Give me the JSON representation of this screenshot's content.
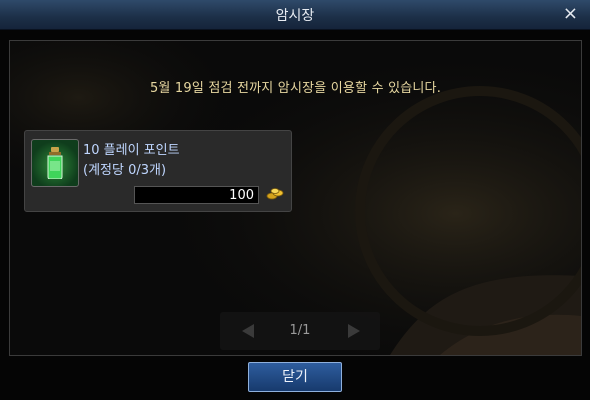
{
  "window": {
    "title": "암시장",
    "close_glyph": "×"
  },
  "notice": "5월 19일 점검 전까지 암시장을 이용할 수 있습니다.",
  "item": {
    "name": "10 플레이 포인트",
    "limit": "(계정당 0/3개)",
    "price": "100",
    "icon": "potion-bottle-icon",
    "currency_icon": "gold-coins-icon"
  },
  "pager": {
    "page": "1/1"
  },
  "footer": {
    "close_label": "닫기"
  },
  "colors": {
    "titlebar": "#1c2f47",
    "notice_text": "#e7d7a0",
    "item_text": "#bfd6ff",
    "button": "#2e5d9e"
  }
}
